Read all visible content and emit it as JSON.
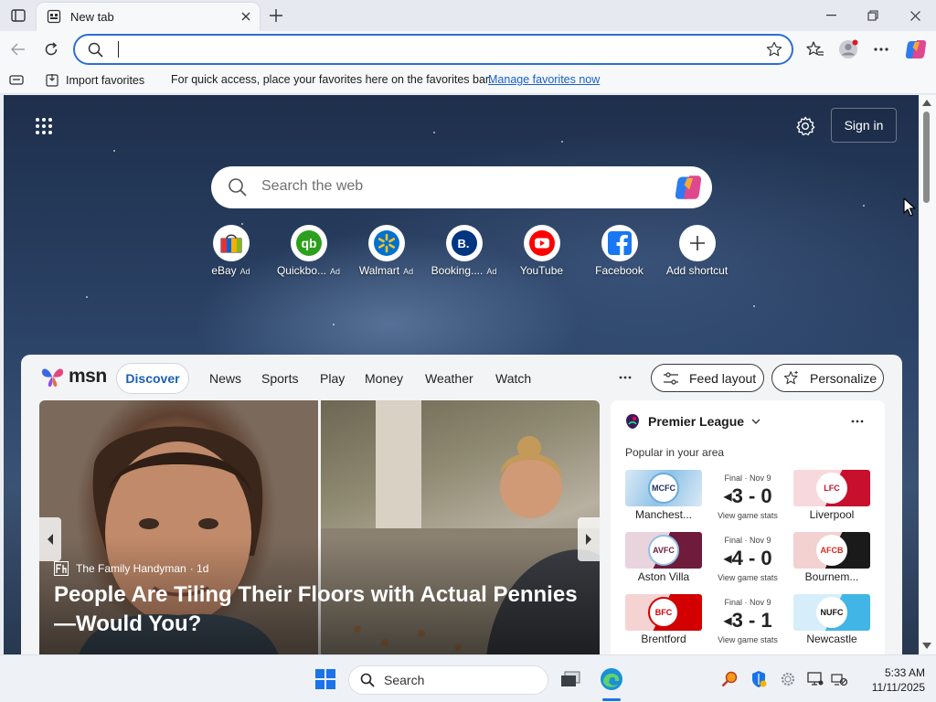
{
  "browser": {
    "tab_title": "New tab",
    "address_value": "",
    "favorites_bar": {
      "import_label": "Import favorites",
      "hint_text": "For quick access, place your favorites here on the favorites bar.",
      "manage_link": "Manage favorites now"
    }
  },
  "newtab": {
    "signin_label": "Sign in",
    "search_placeholder": "Search the web",
    "shortcuts": [
      {
        "label": "eBay",
        "ad": "Ad",
        "icon": "ebay-icon"
      },
      {
        "label": "Quickbo...",
        "ad": "Ad",
        "icon": "quickbooks-icon"
      },
      {
        "label": "Walmart",
        "ad": "Ad",
        "icon": "walmart-icon"
      },
      {
        "label": "Booking....",
        "ad": "Ad",
        "icon": "booking-icon"
      },
      {
        "label": "YouTube",
        "ad": "",
        "icon": "youtube-icon"
      },
      {
        "label": "Facebook",
        "ad": "",
        "icon": "facebook-icon"
      },
      {
        "label": "Add shortcut",
        "ad": "",
        "icon": "plus-icon"
      }
    ]
  },
  "msn": {
    "logo_text": "msn",
    "nav": [
      "Discover",
      "News",
      "Sports",
      "Play",
      "Money",
      "Weather",
      "Watch"
    ],
    "feed_layout_label": "Feed layout",
    "personalize_label": "Personalize",
    "hero": {
      "source": "The Family Handyman",
      "age": "· 1d",
      "headline": "People Are Tiling Their Floors with Actual Pennies—Would You?"
    },
    "premier_league": {
      "title": "Premier League",
      "subtitle": "Popular in your area",
      "matches": [
        {
          "status": "Final · Nov 9",
          "home": "Manchest...",
          "away": "Liverpool",
          "score": "3 - 0",
          "stats": "View game stats",
          "home_color": "#8ec3e8",
          "away_color": "#c8102e"
        },
        {
          "status": "Final · Nov 9",
          "home": "Aston Villa",
          "away": "Bournem...",
          "score": "4 - 0",
          "stats": "View game stats",
          "home_color": "#6e1b3c",
          "away_color": "#1a1a1a"
        },
        {
          "status": "Final · Nov 9",
          "home": "Brentford",
          "away": "Newcastle",
          "score": "3 - 1",
          "stats": "View game stats",
          "home_color": "#d20000",
          "away_color": "#41b6e6"
        }
      ]
    }
  },
  "taskbar": {
    "search_label": "Search",
    "time": "5:33 AM",
    "date": "11/11/2025"
  },
  "colors": {
    "accent": "#2b6fd4",
    "link": "#1660c9"
  }
}
